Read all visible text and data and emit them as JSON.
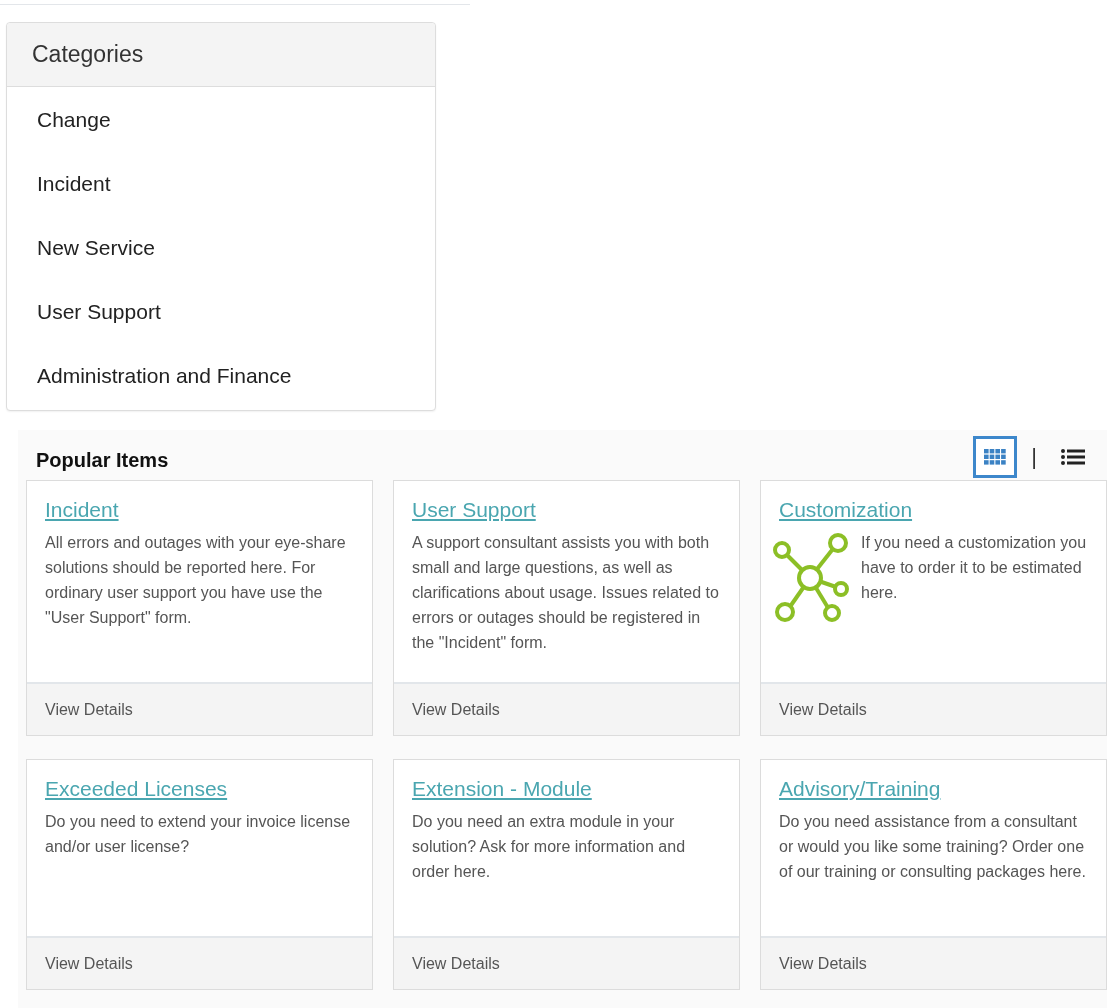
{
  "categories": {
    "title": "Categories",
    "items": [
      {
        "label": "Change"
      },
      {
        "label": "Incident"
      },
      {
        "label": "New Service"
      },
      {
        "label": "User Support"
      },
      {
        "label": "Administration and Finance"
      }
    ]
  },
  "popular": {
    "title": "Popular Items",
    "view_modes": [
      {
        "kind": "grid",
        "selected": true
      },
      {
        "kind": "separator",
        "text": "|"
      },
      {
        "kind": "list",
        "selected": false
      }
    ],
    "cards": [
      {
        "kind": "text",
        "title": "Incident",
        "description": "All errors and outages with your eye-share solutions should be reported here. For ordinary user support you have use the \"User Support\" form.",
        "link": "View Details"
      },
      {
        "kind": "text",
        "title": "User Support",
        "description": "A support consultant assists you with both small and large questions, as well as clarifications about usage. Issues related to errors or outages should be registered in the \"Incident\" form.",
        "link": "View Details"
      },
      {
        "kind": "icon",
        "title": "Customization",
        "description": "If you need a customization you have to order it to be estimated here.",
        "link": "View Details"
      },
      {
        "kind": "text",
        "title": "Exceeded Licenses",
        "description": "Do you need to extend your invoice license and/or user license?",
        "link": "View Details"
      },
      {
        "kind": "text",
        "title": "Extension - Module",
        "description": "Do you need an extra module in your solution? Ask for more information and order here.",
        "link": "View Details"
      },
      {
        "kind": "text",
        "title": "Advisory/Training",
        "description": "Do you need assistance from a consultant or would you like some training? Order one of our training or consulting packages here.",
        "link": "View Details"
      }
    ]
  }
}
